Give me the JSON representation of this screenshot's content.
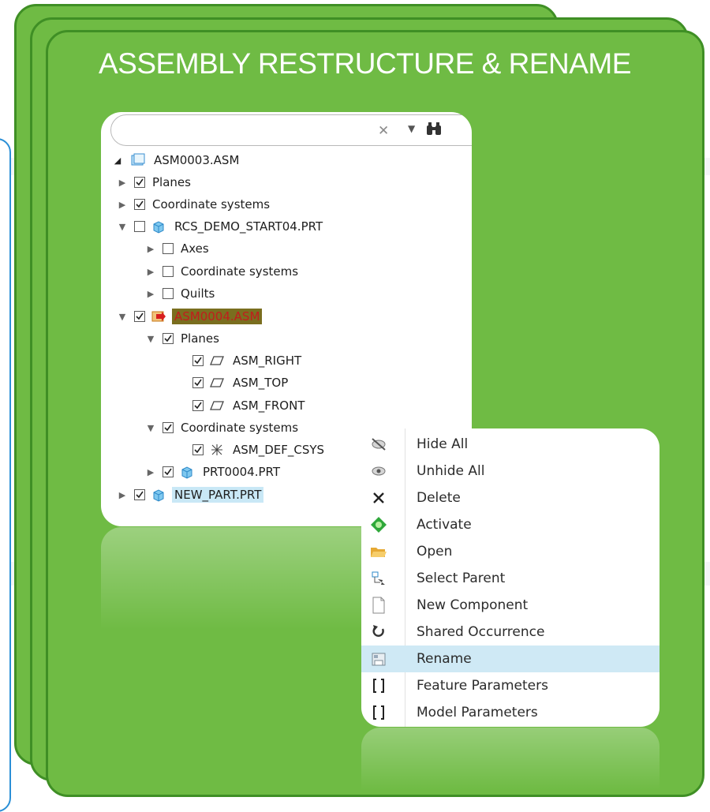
{
  "slide_title": "ASSEMBLY RESTRUCTURE & RENAME",
  "tree": {
    "search_placeholder": "",
    "rows": [
      {
        "label": "ASM0003.ASM"
      },
      {
        "label": "Planes"
      },
      {
        "label": "Coordinate systems"
      },
      {
        "label": "RCS_DEMO_START04.PRT"
      },
      {
        "label": "Axes"
      },
      {
        "label": "Coordinate systems"
      },
      {
        "label": "Quilts"
      },
      {
        "label": "ASM0004.ASM"
      },
      {
        "label": "Planes"
      },
      {
        "label": "ASM_RIGHT"
      },
      {
        "label": "ASM_TOP"
      },
      {
        "label": "ASM_FRONT"
      },
      {
        "label": "Coordinate systems"
      },
      {
        "label": "ASM_DEF_CSYS"
      },
      {
        "label": "PRT0004.PRT"
      },
      {
        "label": "NEW_PART.PRT"
      }
    ]
  },
  "context_menu": {
    "items": [
      {
        "label": "Hide All",
        "icon": "hide-icon"
      },
      {
        "label": "Unhide All",
        "icon": "unhide-icon"
      },
      {
        "label": "Delete",
        "icon": "close-icon"
      },
      {
        "label": "Activate",
        "icon": "activate-icon"
      },
      {
        "label": "Open",
        "icon": "folder-open-icon"
      },
      {
        "label": "Select Parent",
        "icon": "select-parent-icon"
      },
      {
        "label": "New Component",
        "icon": "new-document-icon"
      },
      {
        "label": "Shared Occurrence",
        "icon": "shared-occurrence-icon"
      },
      {
        "label": "Rename",
        "icon": "rename-icon"
      },
      {
        "label": "Feature Parameters",
        "icon": "brackets-icon"
      },
      {
        "label": "Model Parameters",
        "icon": "brackets-icon"
      }
    ],
    "active_item": "Rename"
  },
  "colors": {
    "card_green": "#6fbb44",
    "card_border": "#3f8f25",
    "selection_blue": "#cfe9f5",
    "active_olive": "#7a6e1f"
  }
}
